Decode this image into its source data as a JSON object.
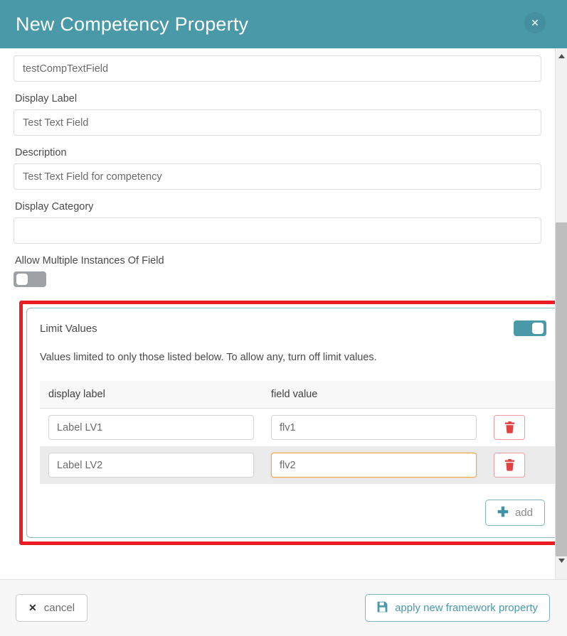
{
  "header": {
    "title": "New Competency Property",
    "close_label": "✕",
    "bg_color": "#4a99a8"
  },
  "form": {
    "fields": [
      {
        "label": "",
        "value": "testCompTextField",
        "placeholder": ""
      },
      {
        "label": "Display Label",
        "value": "Test Text Field",
        "placeholder": ""
      },
      {
        "label": "Description",
        "value": "Test Text Field for competency",
        "placeholder": ""
      },
      {
        "label": "Display Category",
        "value": "",
        "placeholder": ""
      }
    ],
    "allow_multiple": {
      "label": "Allow Multiple Instances Of Field",
      "state": "off"
    }
  },
  "limit_values": {
    "title": "Limit Values",
    "toggle_state": "on",
    "description": "Values limited to only those listed below. To allow any, turn off limit values.",
    "table": {
      "columns": [
        "display label",
        "field value"
      ],
      "rows": [
        {
          "display_label": "Label LV1",
          "field_value": "flv1",
          "focused": false
        },
        {
          "display_label": "Label LV2",
          "field_value": "flv2",
          "focused": true
        }
      ]
    },
    "add_button": {
      "label": "add",
      "icon": "plus-icon"
    },
    "delete_icon": "trash-icon",
    "highlight_color": "#ec1c24"
  },
  "footer": {
    "cancel": {
      "label": "cancel",
      "icon": "close-x-icon"
    },
    "apply": {
      "label": "apply new framework property",
      "icon": "save-icon"
    }
  },
  "scrollbar": {
    "up_arrow": "▲",
    "down_arrow": "▼"
  }
}
